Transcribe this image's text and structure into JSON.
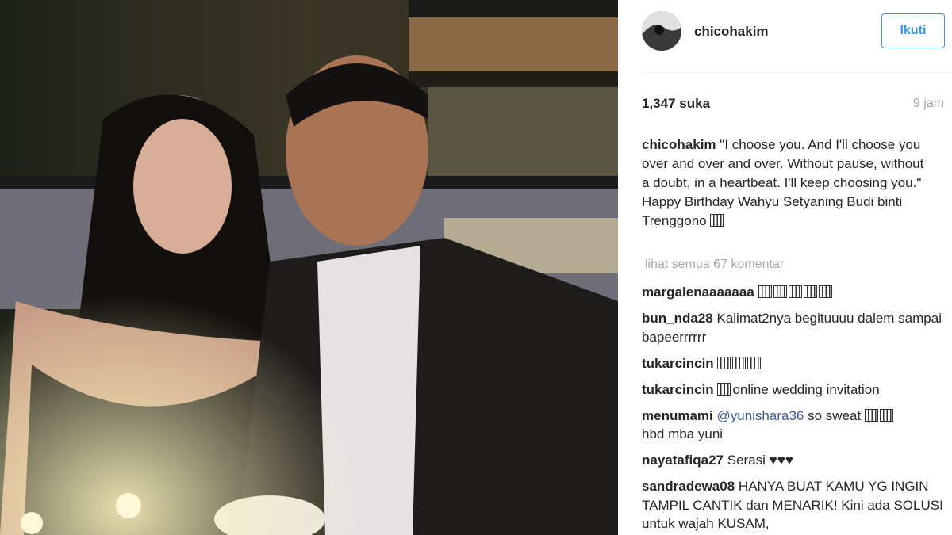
{
  "post": {
    "photo_alt": "chicohakim photo"
  },
  "header": {
    "username": "chicohakim",
    "follow_label": "Ikuti"
  },
  "stats": {
    "likes_count": "1,347",
    "likes_label": "suka",
    "time_ago": "9 jam"
  },
  "caption": {
    "user": "chicohakim",
    "text": "\"I choose you. And I'll choose you over and over and over. Without pause, without a doubt, in a heartbeat. I'll keep choosing you.\" Happy Birthday Wahyu Setyaning Budi binti Trenggono"
  },
  "view_all_comments": "lihat semua 67 komentar",
  "comments": [
    {
      "user": "margalenaaaaaaa",
      "text": ""
    },
    {
      "user": "bun_nda28",
      "text": "Kalimat2nya begituuuu dalem sampai bapeerrrrrr"
    },
    {
      "user": "tukarcincin",
      "text": ""
    },
    {
      "user": "tukarcincin",
      "text": "online wedding invitation"
    },
    {
      "user": "menumami",
      "mention": "@yunishara36",
      "text": "so sweat",
      "text2": "hbd mba yuni"
    },
    {
      "user": "nayatafiqa27",
      "text": "Serasi ♥♥♥"
    },
    {
      "user": "sandradewa08",
      "text": "HANYA BUAT KAMU YG INGIN TAMPIL CANTIK dan MENARIK! Kini ada SOLUSI untuk wajah KUSAM,"
    }
  ],
  "colors": {
    "accent": "#3897f0",
    "muted": "#a5a7aa",
    "text": "#262626",
    "mention": "#3b5998"
  }
}
